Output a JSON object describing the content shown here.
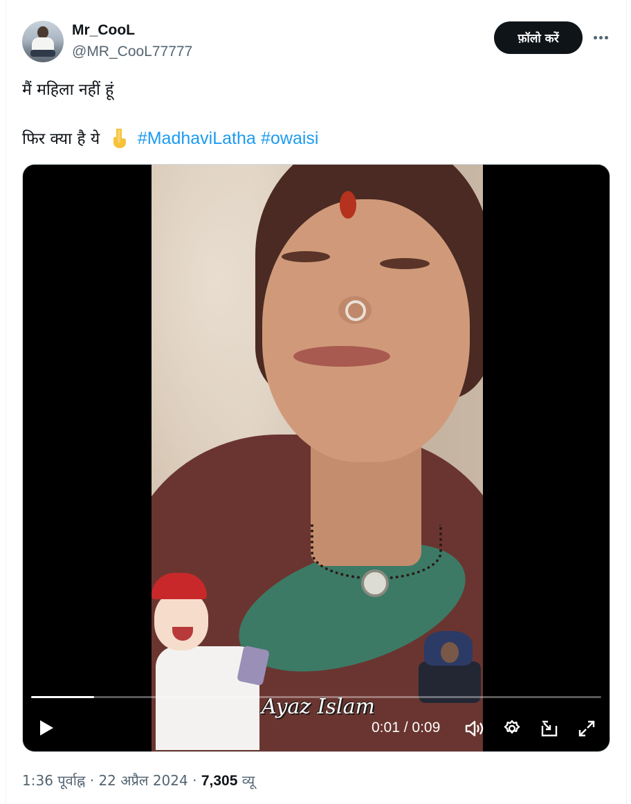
{
  "user": {
    "display_name": "Mr_CooL",
    "handle": "@MR_CooL77777"
  },
  "header": {
    "follow_label": "फ़ॉलो करें",
    "more_icon": "more-horizontal-icon"
  },
  "post": {
    "line1": "मैं महिला नहीं हूं",
    "line2_text": "फिर क्या है ये",
    "emoji": "backhand-index-pointing-down-icon",
    "hashtags": [
      "#MadhaviLatha",
      "#owaisi"
    ]
  },
  "video": {
    "watermark": "Ayaz Islam",
    "current_time": "0:01",
    "separator": "/",
    "duration": "0:09",
    "progress_fraction": 0.11,
    "icons": [
      "play-icon",
      "volume-icon",
      "settings-icon",
      "picture-in-picture-icon",
      "fullscreen-icon"
    ]
  },
  "meta": {
    "time": "1:36 पूर्वाह्न",
    "dot1": "·",
    "date": "22 अप्रैल 2024",
    "dot2": "·",
    "views_count": "7,305",
    "views_label": "व्यू"
  },
  "colors": {
    "link": "#1d9bf0",
    "text": "#0f1419",
    "secondary": "#536471",
    "button_bg": "#0f1419"
  }
}
